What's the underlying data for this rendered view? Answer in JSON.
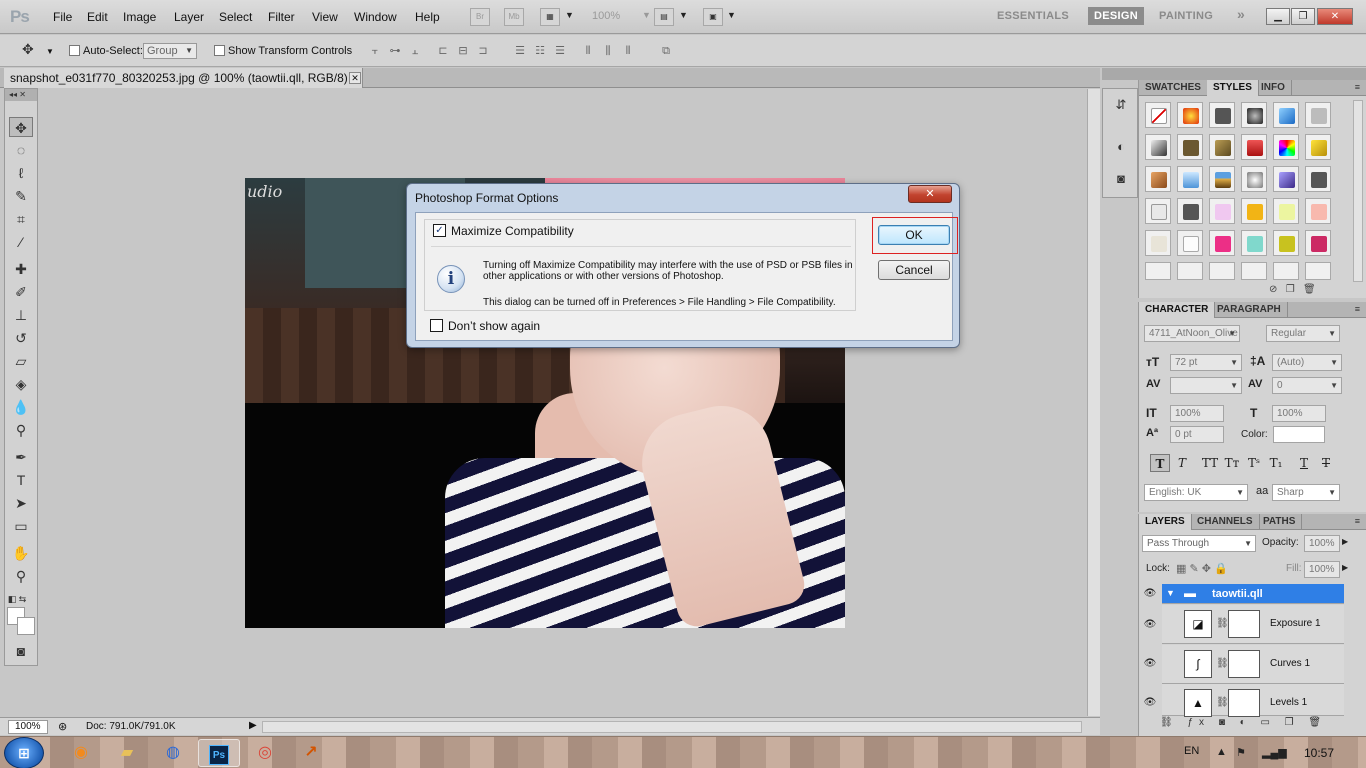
{
  "app": {
    "logo": "Ps"
  },
  "menubar": {
    "items": [
      "File",
      "Edit",
      "Image",
      "Layer",
      "Select",
      "Filter",
      "View",
      "Window",
      "Help"
    ],
    "bridge": "Br",
    "mini_bridge": "Mb",
    "zoom": "100%",
    "workspaces": [
      "ESSENTIALS",
      "DESIGN",
      "PAINTING"
    ],
    "more_workspaces": "»"
  },
  "options_bar": {
    "auto_select_label": "Auto-Select:",
    "auto_select_value": "Group",
    "show_transform_label": "Show Transform Controls"
  },
  "document": {
    "tab_title": "snapshot_e031f770_80320253.jpg @ 100% (taowtii.qll, RGB/8) *",
    "photo_watermark": "udio"
  },
  "status": {
    "zoom": "100%",
    "doc_size": "Doc: 791.0K/791.0K"
  },
  "panels": {
    "swatches_tabs": [
      "SWATCHES",
      "STYLES",
      "INFO"
    ],
    "character_tabs": [
      "CHARACTER",
      "PARAGRAPH"
    ],
    "character": {
      "font_family": "4711_AtNoon_Olive",
      "font_style": "Regular",
      "font_size": "72 pt",
      "leading": "(Auto)",
      "kerning": "",
      "tracking": "0",
      "vertical_scale": "100%",
      "horizontal_scale": "100%",
      "baseline_shift": "0 pt",
      "color_label": "Color:",
      "language": "English: UK",
      "antialias": "Sharp",
      "aa_label": "aa"
    },
    "layers_tabs": [
      "LAYERS",
      "CHANNELS",
      "PATHS"
    ],
    "layers": {
      "blend_mode": "Pass Through",
      "opacity_label": "Opacity:",
      "opacity": "100%",
      "lock_label": "Lock:",
      "fill_label": "Fill:",
      "fill": "100%",
      "group_name": "taowtii.qll",
      "items": [
        "Exposure 1",
        "Curves 1",
        "Levels 1"
      ]
    }
  },
  "dialog": {
    "title": "Photoshop Format Options",
    "maximize_label": "Maximize Compatibility",
    "message": "Turning off Maximize Compatibility may interfere with the use of PSD or PSB files in other applications or with other versions of Photoshop.",
    "message2": "This dialog can be turned off in Preferences > File Handling > File Compatibility.",
    "dont_show_label": "Don’t show again",
    "ok_label": "OK",
    "cancel_label": "Cancel",
    "close_glyph": "✕"
  },
  "taskbar": {
    "language": "EN",
    "time": "10:57",
    "ps_label": "Ps"
  }
}
